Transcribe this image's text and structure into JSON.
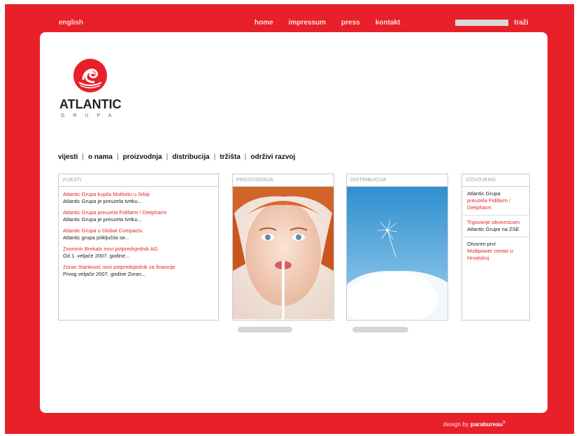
{
  "topbar": {
    "lang_label": "english",
    "nav": [
      "home",
      "impressum",
      "press",
      "kontakt"
    ],
    "search_label": "traži",
    "search_value": ""
  },
  "logo": {
    "word": "ATLANTIC",
    "sub": "GRUPA"
  },
  "mainnav": [
    "vijesti",
    "o nama",
    "proizvodnja",
    "distribucija",
    "tržišta",
    "održivi razvoj"
  ],
  "news": {
    "header": "VIJESTI",
    "items": [
      {
        "title": "Atlantic Grupa kupila Multivitu u Srbiji",
        "desc": "Atlantic Grupa je preuzela tvrtku..."
      },
      {
        "title": "Atlantic Grupa preuzela Fidifarm / Dietpharm",
        "desc": "Atlantic Grupa je preuzela tvrtku..."
      },
      {
        "title": "Atlantic Grupa u Global Compactu",
        "desc": "Atlantic grupa priključila se..."
      },
      {
        "title": "Zvonimir Brekalo novi potpredsjednik AG",
        "desc": "Od 1. veljače 2007. godine..."
      },
      {
        "title": "Zoran Stanković novi potpredsjednik za financije",
        "desc": "Prvog veljače 2007. godine Zoran..."
      }
    ]
  },
  "production": {
    "header": "PROIZVODNJA"
  },
  "distribution": {
    "header": "DISTRIBUCIJA"
  },
  "featured": {
    "header": "IZDVOJENO",
    "items": [
      {
        "d1": "Atlantic Grupa",
        "t": "preuzela Fidifarm / Dietpharm",
        "d2": ""
      },
      {
        "d1": "",
        "t": "Trgovanje obveznicom",
        "d2": "Atlantic Grupe na ZSE"
      },
      {
        "d1": "Otvoren prvi",
        "t": "Multipower centar u Hrvatskoj",
        "d2": ""
      }
    ]
  },
  "credit": {
    "prefix": "design by",
    "brand": "parabureau"
  },
  "colors": {
    "brand": "#e8202a",
    "panel": "#ffffff"
  }
}
